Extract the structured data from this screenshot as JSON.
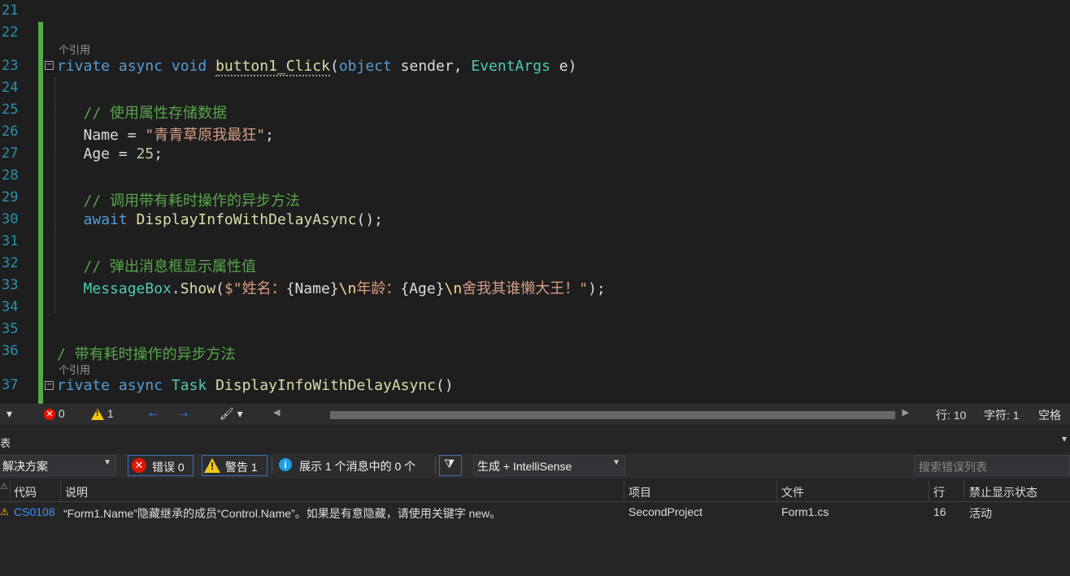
{
  "editor": {
    "lines": [
      {
        "num": "21",
        "tokens": [
          {
            "t": " ",
            "c": "pl"
          }
        ]
      },
      {
        "num": "22",
        "tokens": []
      },
      {
        "num": "23",
        "tokens": [
          {
            "t": "rivate ",
            "c": "kw"
          },
          {
            "t": "async ",
            "c": "kw"
          },
          {
            "t": "void ",
            "c": "kw"
          },
          {
            "t": "button1_Click",
            "c": "df"
          },
          {
            "t": "(",
            "c": "pl"
          },
          {
            "t": "object ",
            "c": "kw"
          },
          {
            "t": "sender, ",
            "c": "pl"
          },
          {
            "t": "EventArgs ",
            "c": "ty"
          },
          {
            "t": "e)",
            "c": "pl"
          }
        ]
      },
      {
        "num": "24",
        "tokens": []
      },
      {
        "num": "25",
        "tokens": [
          {
            "t": "   // 使用属性存储数据",
            "c": "cm"
          }
        ]
      },
      {
        "num": "26",
        "tokens": [
          {
            "t": "   Name = ",
            "c": "pl"
          },
          {
            "t": "\"青青草原我最狂\"",
            "c": "st"
          },
          {
            "t": ";",
            "c": "pl"
          }
        ]
      },
      {
        "num": "27",
        "tokens": [
          {
            "t": "   Age = ",
            "c": "pl"
          },
          {
            "t": "25",
            "c": "nm"
          },
          {
            "t": ";",
            "c": "pl"
          }
        ]
      },
      {
        "num": "28",
        "tokens": []
      },
      {
        "num": "29",
        "tokens": [
          {
            "t": "   // 调用带有耗时操作的异步方法",
            "c": "cm"
          }
        ]
      },
      {
        "num": "30",
        "tokens": [
          {
            "t": "   ",
            "c": "pl"
          },
          {
            "t": "await ",
            "c": "kw"
          },
          {
            "t": "DisplayInfoWithDelayAsync",
            "c": "fn"
          },
          {
            "t": "();",
            "c": "pl"
          }
        ]
      },
      {
        "num": "31",
        "tokens": []
      },
      {
        "num": "32",
        "tokens": [
          {
            "t": "   // 弹出消息框显示属性值",
            "c": "cm"
          }
        ]
      },
      {
        "num": "33",
        "tokens": [
          {
            "t": "   ",
            "c": "pl"
          },
          {
            "t": "MessageBox",
            "c": "ty"
          },
          {
            "t": ".",
            "c": "pl"
          },
          {
            "t": "Show",
            "c": "fn"
          },
          {
            "t": "(",
            "c": "pl"
          },
          {
            "t": "$\"姓名：",
            "c": "st"
          },
          {
            "t": "{Name}",
            "c": "pl"
          },
          {
            "t": "\\n",
            "c": "esc"
          },
          {
            "t": "年龄：",
            "c": "st"
          },
          {
            "t": "{Age}",
            "c": "pl"
          },
          {
            "t": "\\n",
            "c": "esc"
          },
          {
            "t": "舍我其谁懒大王！\"",
            "c": "st"
          },
          {
            "t": ");",
            "c": "pl"
          }
        ]
      },
      {
        "num": "34",
        "tokens": []
      },
      {
        "num": "35",
        "tokens": []
      },
      {
        "num": "36",
        "tokens": [
          {
            "t": "/ 带有耗时操作的异步方法",
            "c": "cm"
          }
        ]
      },
      {
        "num": "37",
        "tokens": [
          {
            "t": "rivate ",
            "c": "kw"
          },
          {
            "t": "async ",
            "c": "kw"
          },
          {
            "t": "Task ",
            "c": "ty"
          },
          {
            "t": "DisplayInfoWithDelayAsync",
            "c": "df"
          },
          {
            "t": "()",
            "c": "pl"
          }
        ]
      }
    ],
    "codelens_1": "个引用",
    "codelens_2": "个引用"
  },
  "status": {
    "errors": "0",
    "warnings": "1",
    "line": "行: 10",
    "char": "字符: 1",
    "spaces": "空格"
  },
  "panel": {
    "title": "表",
    "scope": "解决方案",
    "errors_btn": "错误 0",
    "warnings_btn": "警告 1",
    "messages_btn": "展示 1 个消息中的 0 个",
    "build_filter": "生成 + IntelliSense",
    "search_placeholder": "搜索错误列表",
    "columns": {
      "code": "代码",
      "desc": "说明",
      "project": "项目",
      "file": "文件",
      "line": "行",
      "suppress": "禁止显示状态"
    },
    "rows": [
      {
        "code": "CS0108",
        "desc": "“Form1.Name”隐藏继承的成员“Control.Name”。如果是有意隐藏，请使用关键字 new。",
        "project": "SecondProject",
        "file": "Form1.cs",
        "line": "16",
        "suppress": "活动"
      }
    ]
  }
}
